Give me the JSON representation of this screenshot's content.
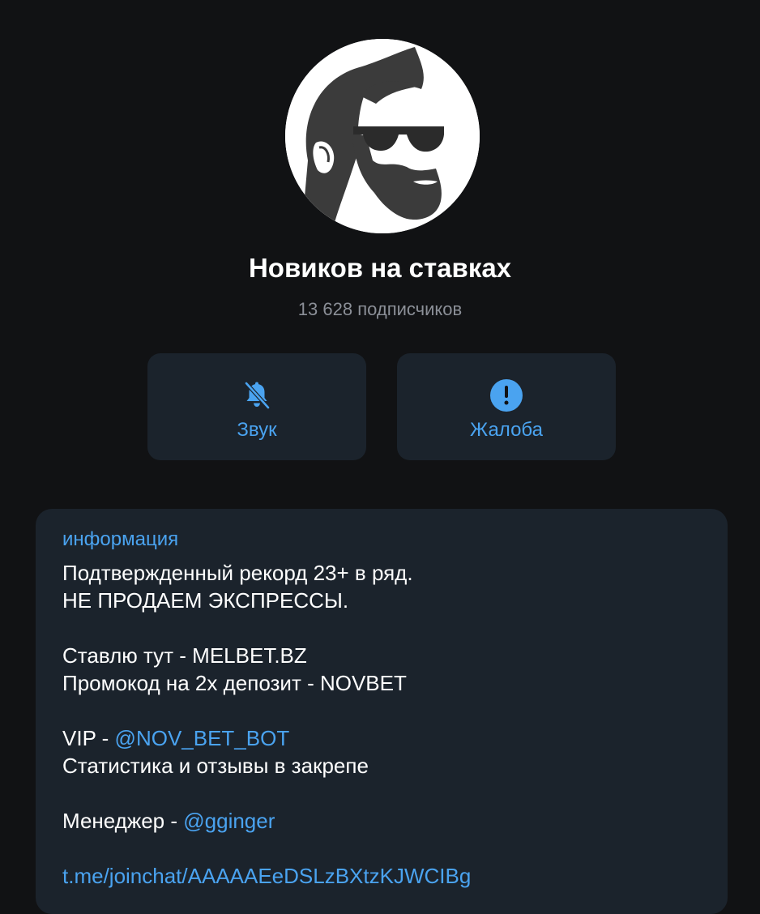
{
  "channel": {
    "title": "Новиков на ставках",
    "subscribers": "13 628 подписчиков"
  },
  "actions": [
    {
      "label": "Звук",
      "icon": "bell-muted-icon"
    },
    {
      "label": "Жалоба",
      "icon": "exclamation-circle-icon"
    }
  ],
  "info": {
    "heading": "информация",
    "line1": "Подтвержденный рекорд 23+ в ряд.",
    "line2": "НЕ ПРОДАЕМ ЭКСПРЕССЫ.",
    "line3": "Ставлю тут - MELBET.BZ",
    "line4": "Промокод на 2х депозит - NOVBET",
    "vip_prefix": "VIP - ",
    "vip_link": "@NOV_BET_BOT",
    "line6": "Статистика и отзывы в закрепе",
    "manager_prefix": "Менеджер - ",
    "manager_link": "@gginger",
    "invite_link": "t.me/joinchat/AAAAAEeDSLzBXtzKJWCIBg"
  },
  "colors": {
    "background": "#111214",
    "card": "#1b232c",
    "accent": "#4aa3f0",
    "muted": "#8b8f97"
  }
}
